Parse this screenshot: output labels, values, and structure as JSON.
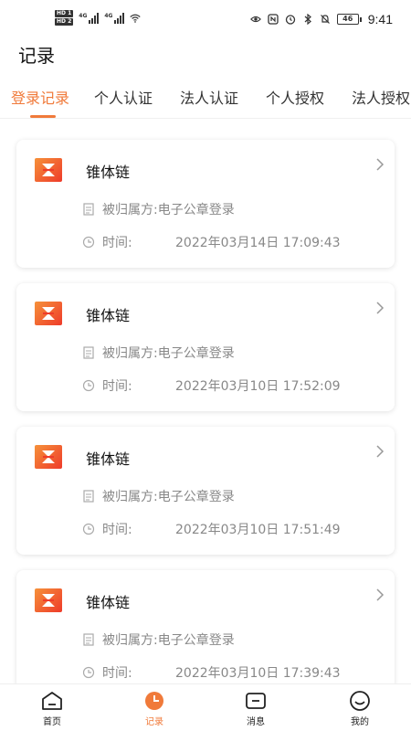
{
  "status_bar": {
    "hd1": "HD 1",
    "hd2": "HD 2",
    "net1": "4G",
    "net2": "4G",
    "battery": "46",
    "time": "9:41"
  },
  "page_title": "记录",
  "tabs": [
    {
      "label": "登录记录",
      "active": true
    },
    {
      "label": "个人认证",
      "active": false
    },
    {
      "label": "法人认证",
      "active": false
    },
    {
      "label": "个人授权",
      "active": false
    },
    {
      "label": "法人授权",
      "active": false
    }
  ],
  "records": [
    {
      "title": "锥体链",
      "owner_label": "被归属方:",
      "owner_value": "电子公章登录",
      "time_label": "时间:",
      "time_value": "2022年03月14日 17:09:43"
    },
    {
      "title": "锥体链",
      "owner_label": "被归属方:",
      "owner_value": "电子公章登录",
      "time_label": "时间:",
      "time_value": "2022年03月10日 17:52:09"
    },
    {
      "title": "锥体链",
      "owner_label": "被归属方:",
      "owner_value": "电子公章登录",
      "time_label": "时间:",
      "time_value": "2022年03月10日 17:51:49"
    },
    {
      "title": "锥体链",
      "owner_label": "被归属方:",
      "owner_value": "电子公章登录",
      "time_label": "时间:",
      "time_value": "2022年03月10日 17:39:43"
    }
  ],
  "bottom_nav": [
    {
      "label": "首页",
      "icon": "home-icon",
      "active": false
    },
    {
      "label": "记录",
      "icon": "clock-icon",
      "active": true
    },
    {
      "label": "消息",
      "icon": "message-icon",
      "active": false
    },
    {
      "label": "我的",
      "icon": "profile-icon",
      "active": false
    }
  ],
  "colors": {
    "accent": "#f07a3a",
    "logo_gradient_start": "#f6913a",
    "logo_gradient_end": "#ee3b2a",
    "muted_text": "#888888"
  }
}
